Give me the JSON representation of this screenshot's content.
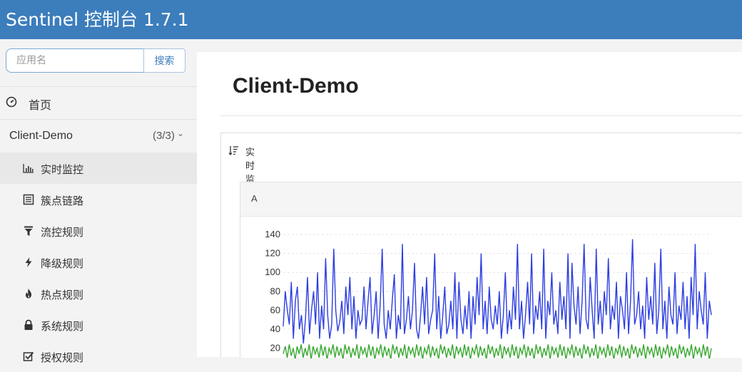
{
  "header": {
    "title": "Sentinel 控制台 1.7.1"
  },
  "sidebar": {
    "search": {
      "placeholder": "应用名",
      "button_label": "搜索"
    },
    "home_label": "首页",
    "app": {
      "name": "Client-Demo",
      "count": "(3/3)",
      "chevron": "chevron-down-icon"
    },
    "items": [
      {
        "label": "实时监控",
        "icon": "bar-chart-icon",
        "active": true
      },
      {
        "label": "簇点链路",
        "icon": "list-icon",
        "active": false
      },
      {
        "label": "流控规则",
        "icon": "filter-icon",
        "active": false
      },
      {
        "label": "降级规则",
        "icon": "flash-icon",
        "active": false
      },
      {
        "label": "热点规则",
        "icon": "fire-icon",
        "active": false
      },
      {
        "label": "系统规则",
        "icon": "lock-icon",
        "active": false
      },
      {
        "label": "授权规则",
        "icon": "check-square-icon",
        "active": false
      }
    ]
  },
  "main": {
    "page_title": "Client-Demo",
    "panel_title": "实时监控",
    "card_title": "A"
  },
  "colors": {
    "header_bg": "#3c7dbc",
    "pass_series": "#2d3ee0",
    "block_series": "#3aa832"
  },
  "chart_data": {
    "type": "line",
    "title": "",
    "xlabel": "",
    "ylabel": "",
    "y_ticks": [
      20,
      40,
      60,
      80,
      100,
      120,
      140
    ],
    "ylim": [
      0,
      140
    ],
    "grid": true,
    "series": [
      {
        "color": "#2d3ee0",
        "values": [
          43,
          80,
          60,
          45,
          90,
          30,
          70,
          85,
          40,
          55,
          25,
          50,
          95,
          35,
          60,
          80,
          45,
          100,
          30,
          65,
          40,
          115,
          55,
          30,
          45,
          125,
          60,
          38,
          48,
          70,
          35,
          85,
          55,
          95,
          40,
          75,
          30,
          60,
          45,
          50,
          85,
          40,
          70,
          95,
          35,
          55,
          80,
          30,
          65,
          125,
          45,
          30,
          60,
          40,
          70,
          98,
          30,
          55,
          40,
          130,
          35,
          50,
          75,
          40,
          60,
          110,
          40,
          30,
          55,
          85,
          45,
          95,
          35,
          50,
          60,
          120,
          40,
          75,
          30,
          55,
          85,
          35,
          45,
          70,
          40,
          100,
          30,
          90,
          50,
          35,
          65,
          40,
          80,
          30,
          75,
          45,
          95,
          55,
          120,
          40,
          70,
          35,
          85,
          50,
          40,
          65,
          45,
          80,
          30,
          55,
          100,
          35,
          60,
          40,
          85,
          50,
          130,
          40,
          70,
          30,
          55,
          90,
          45,
          120,
          35,
          65,
          50,
          80,
          40,
          125,
          30,
          70,
          55,
          100,
          45,
          60,
          35,
          90,
          50,
          75,
          40,
          120,
          30,
          110,
          65,
          45,
          85,
          35,
          70,
          130,
          50,
          40,
          95,
          60,
          30,
          125,
          45,
          70,
          35,
          80,
          55,
          115,
          40,
          65,
          50,
          90,
          30,
          75,
          60,
          40,
          100,
          35,
          70,
          135,
          45,
          55,
          80,
          40,
          65,
          30,
          95,
          50,
          75,
          45,
          110,
          35,
          60,
          125,
          40,
          70,
          30,
          85,
          55,
          45,
          100,
          35,
          65,
          50,
          90,
          40,
          75,
          30,
          95,
          55,
          130,
          40,
          80,
          60,
          45,
          100,
          30,
          70,
          55
        ]
      },
      {
        "color": "#3aa832",
        "values": [
          14,
          22,
          10,
          24,
          12,
          20,
          8,
          22,
          14,
          24,
          10,
          20,
          12,
          24,
          8,
          22,
          14,
          20,
          10,
          24,
          12,
          22,
          8,
          20,
          14,
          24,
          10,
          22,
          12,
          20,
          8,
          24,
          14,
          22,
          10,
          20,
          12,
          24,
          8,
          22,
          14,
          20,
          10,
          24,
          12,
          22,
          8,
          20,
          14,
          24,
          10,
          22,
          12,
          20,
          8,
          24,
          14,
          22,
          10,
          20,
          12,
          24,
          8,
          22,
          14,
          20,
          10,
          24,
          12,
          22,
          8,
          20,
          14,
          24,
          10,
          22,
          12,
          20,
          8,
          24,
          14,
          22,
          10,
          20,
          12,
          24,
          8,
          22,
          14,
          20,
          10,
          24,
          12,
          22,
          8,
          20,
          14,
          24,
          10,
          22,
          12,
          20,
          8,
          24,
          14,
          22,
          10,
          20,
          12,
          24,
          8,
          22,
          14,
          20,
          10,
          24,
          12,
          22,
          8,
          20,
          14,
          24,
          10,
          22,
          12,
          20,
          8,
          24,
          14,
          22,
          10,
          20,
          12,
          24,
          8,
          22,
          14,
          20,
          10,
          24,
          12,
          22,
          8,
          20,
          14,
          24,
          10,
          22,
          12,
          20,
          8,
          24,
          14,
          22,
          10,
          20,
          12,
          24,
          8,
          22,
          14,
          20,
          10,
          24,
          12,
          22,
          8,
          20,
          14,
          24,
          10,
          22,
          12,
          20,
          8,
          24,
          14,
          22,
          10,
          20,
          12,
          24,
          8,
          22,
          14,
          20,
          10,
          24,
          12,
          22,
          8,
          20,
          14,
          24,
          10,
          22,
          12,
          20,
          8,
          24,
          14,
          22,
          10,
          20,
          12,
          24,
          8,
          22,
          14,
          20,
          10,
          24,
          12,
          22,
          8,
          20
        ]
      }
    ]
  }
}
